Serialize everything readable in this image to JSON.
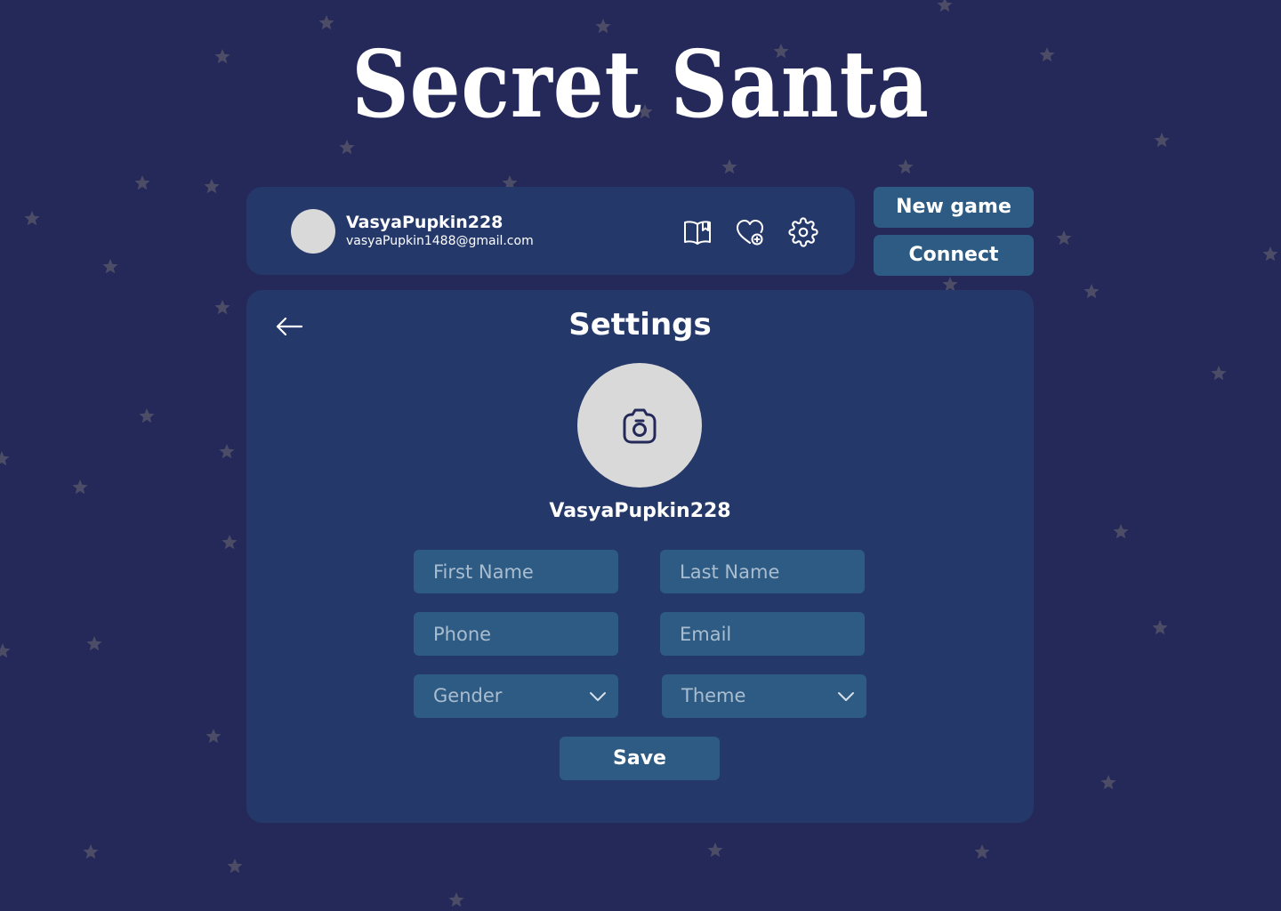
{
  "app": {
    "title": "Secret Santa"
  },
  "profile": {
    "username": "VasyaPupkin228",
    "email": "vasyaPupkin1488@gmail.com"
  },
  "header_icons": {
    "rules": "open-book-icon",
    "wishlist": "heart-add-icon",
    "settings": "gear-icon"
  },
  "actions": {
    "new_game": "New game",
    "connect": "Connect"
  },
  "settings": {
    "title": "Settings",
    "back_icon": "arrow-left-icon",
    "photo_icon": "camera-icon",
    "username": "VasyaPupkin228",
    "fields": {
      "first_name_placeholder": "First Name",
      "last_name_placeholder": "Last Name",
      "phone_placeholder": "Phone",
      "email_placeholder": "Email"
    },
    "selects": {
      "gender": "Gender",
      "theme": "Theme"
    },
    "save_label": "Save"
  },
  "colors": {
    "background": "#24295a",
    "panel": "#25386a",
    "button": "#2e5b83",
    "avatar": "#d9d9d9",
    "star": "#4c4c66",
    "placeholder": "#a9bdd0"
  }
}
